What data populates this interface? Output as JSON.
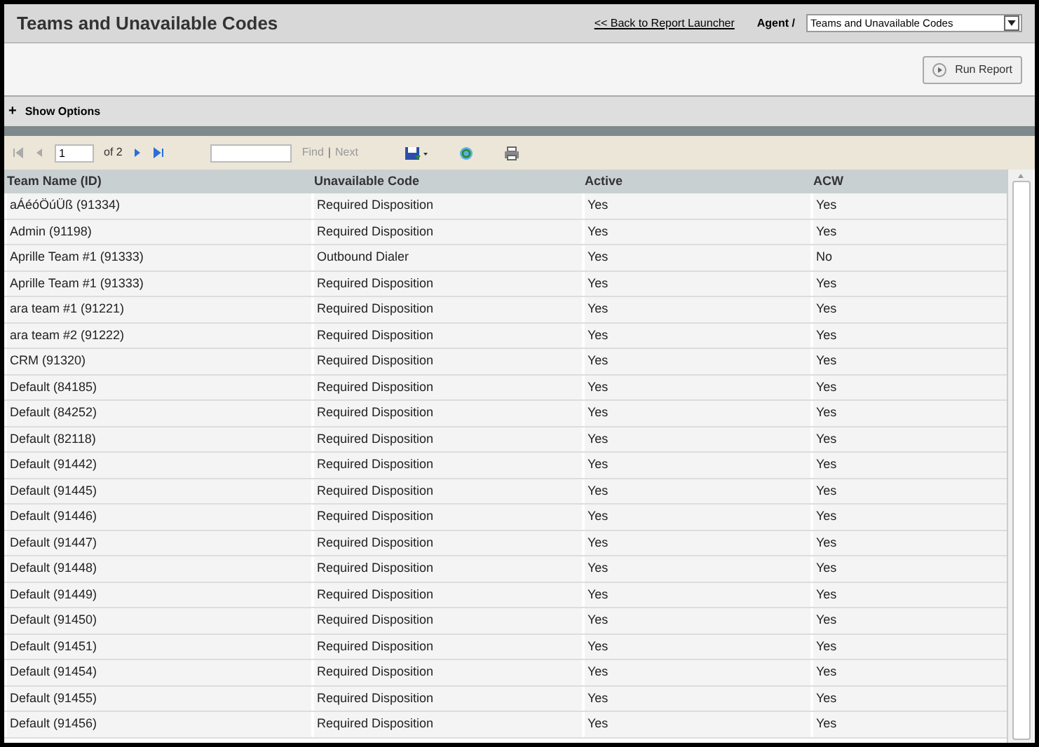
{
  "header": {
    "title": "Teams and Unavailable Codes",
    "back_link": "<< Back to Report Launcher",
    "breadcrumb": "Agent /",
    "report_select": "Teams and Unavailable Codes"
  },
  "run_button": "Run Report",
  "options": {
    "label": "Show Options",
    "expand_glyph": "+"
  },
  "toolbar": {
    "page": "1",
    "page_count": "of 2",
    "find": "Find",
    "separator": "|",
    "next": "Next"
  },
  "table": {
    "columns": [
      "Team Name (ID)",
      "Unavailable Code",
      "Active",
      "ACW"
    ],
    "rows": [
      [
        "aÁéóÖúÜß (91334)",
        "Required Disposition",
        "Yes",
        "Yes"
      ],
      [
        "Admin (91198)",
        "Required Disposition",
        "Yes",
        "Yes"
      ],
      [
        "Aprille Team #1 (91333)",
        "Outbound Dialer",
        "Yes",
        "No"
      ],
      [
        "Aprille Team #1 (91333)",
        "Required Disposition",
        "Yes",
        "Yes"
      ],
      [
        "ara team #1 (91221)",
        "Required Disposition",
        "Yes",
        "Yes"
      ],
      [
        "ara team #2 (91222)",
        "Required Disposition",
        "Yes",
        "Yes"
      ],
      [
        "CRM (91320)",
        "Required Disposition",
        "Yes",
        "Yes"
      ],
      [
        "Default (84185)",
        "Required Disposition",
        "Yes",
        "Yes"
      ],
      [
        "Default (84252)",
        "Required Disposition",
        "Yes",
        "Yes"
      ],
      [
        "Default (82118)",
        "Required Disposition",
        "Yes",
        "Yes"
      ],
      [
        "Default (91442)",
        "Required Disposition",
        "Yes",
        "Yes"
      ],
      [
        "Default (91445)",
        "Required Disposition",
        "Yes",
        "Yes"
      ],
      [
        "Default (91446)",
        "Required Disposition",
        "Yes",
        "Yes"
      ],
      [
        "Default (91447)",
        "Required Disposition",
        "Yes",
        "Yes"
      ],
      [
        "Default (91448)",
        "Required Disposition",
        "Yes",
        "Yes"
      ],
      [
        "Default (91449)",
        "Required Disposition",
        "Yes",
        "Yes"
      ],
      [
        "Default (91450)",
        "Required Disposition",
        "Yes",
        "Yes"
      ],
      [
        "Default (91451)",
        "Required Disposition",
        "Yes",
        "Yes"
      ],
      [
        "Default (91454)",
        "Required Disposition",
        "Yes",
        "Yes"
      ],
      [
        "Default (91455)",
        "Required Disposition",
        "Yes",
        "Yes"
      ],
      [
        "Default (91456)",
        "Required Disposition",
        "Yes",
        "Yes"
      ]
    ]
  }
}
